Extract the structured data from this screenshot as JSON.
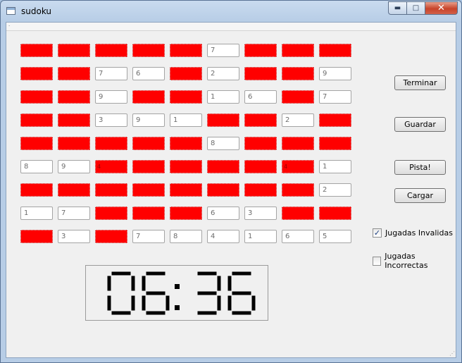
{
  "window": {
    "title": "sudoku",
    "minimize_glyph": "▬",
    "maximize_glyph": "□",
    "close_glyph": "✕"
  },
  "menubar": {
    "grip": "·"
  },
  "board": {
    "rows": [
      [
        "",
        "",
        "",
        "",
        "",
        "7",
        "",
        "",
        ""
      ],
      [
        "",
        "",
        "7",
        "6",
        "",
        "2",
        "",
        "",
        "9"
      ],
      [
        "",
        "",
        "9",
        "",
        "",
        "1",
        "6",
        "",
        "7"
      ],
      [
        "",
        "",
        "3",
        "9",
        "1",
        "",
        "",
        "2",
        ""
      ],
      [
        "",
        "",
        "",
        "",
        "",
        "8",
        "",
        "",
        ""
      ],
      [
        "8",
        "9",
        "4",
        "",
        "",
        "",
        "",
        "4",
        "1"
      ],
      [
        "",
        "",
        "",
        "",
        "",
        "",
        "",
        "",
        "2"
      ],
      [
        "1",
        "7",
        "",
        "",
        "",
        "6",
        "3",
        "",
        ""
      ],
      [
        "",
        "3",
        "",
        "7",
        "8",
        "4",
        "1",
        "6",
        "5"
      ]
    ],
    "empty_cells": [
      [
        0,
        0
      ],
      [
        0,
        1
      ],
      [
        0,
        2
      ],
      [
        0,
        3
      ],
      [
        0,
        4
      ],
      [
        0,
        6
      ],
      [
        0,
        7
      ],
      [
        0,
        8
      ],
      [
        1,
        0
      ],
      [
        1,
        1
      ],
      [
        1,
        4
      ],
      [
        1,
        6
      ],
      [
        1,
        7
      ],
      [
        2,
        0
      ],
      [
        2,
        1
      ],
      [
        2,
        3
      ],
      [
        2,
        4
      ],
      [
        2,
        7
      ],
      [
        3,
        0
      ],
      [
        3,
        1
      ],
      [
        3,
        5
      ],
      [
        3,
        6
      ],
      [
        3,
        8
      ],
      [
        4,
        0
      ],
      [
        4,
        1
      ],
      [
        4,
        2
      ],
      [
        4,
        3
      ],
      [
        4,
        4
      ],
      [
        4,
        6
      ],
      [
        4,
        7
      ],
      [
        4,
        8
      ],
      [
        5,
        2
      ],
      [
        5,
        3
      ],
      [
        5,
        4
      ],
      [
        5,
        5
      ],
      [
        5,
        6
      ],
      [
        5,
        7
      ],
      [
        6,
        0
      ],
      [
        6,
        1
      ],
      [
        6,
        2
      ],
      [
        6,
        3
      ],
      [
        6,
        4
      ],
      [
        6,
        5
      ],
      [
        6,
        6
      ],
      [
        6,
        7
      ],
      [
        7,
        2
      ],
      [
        7,
        3
      ],
      [
        7,
        4
      ],
      [
        7,
        7
      ],
      [
        7,
        8
      ],
      [
        8,
        0
      ],
      [
        8,
        2
      ]
    ],
    "invalid_color": "#ff0000"
  },
  "buttons": {
    "terminar": "Terminar",
    "guardar": "Guardar",
    "pista": "Pista!",
    "cargar": "Cargar"
  },
  "checks": {
    "invalidas": {
      "label": "Jugadas Invalidas",
      "checked": true,
      "mark": "✓"
    },
    "incorrectas": {
      "label": "Jugadas Incorrectas",
      "checked": false,
      "mark": ""
    }
  },
  "timer": {
    "minutes": "06",
    "seconds": "36"
  },
  "statusbar": {
    "grip": "⋰"
  }
}
